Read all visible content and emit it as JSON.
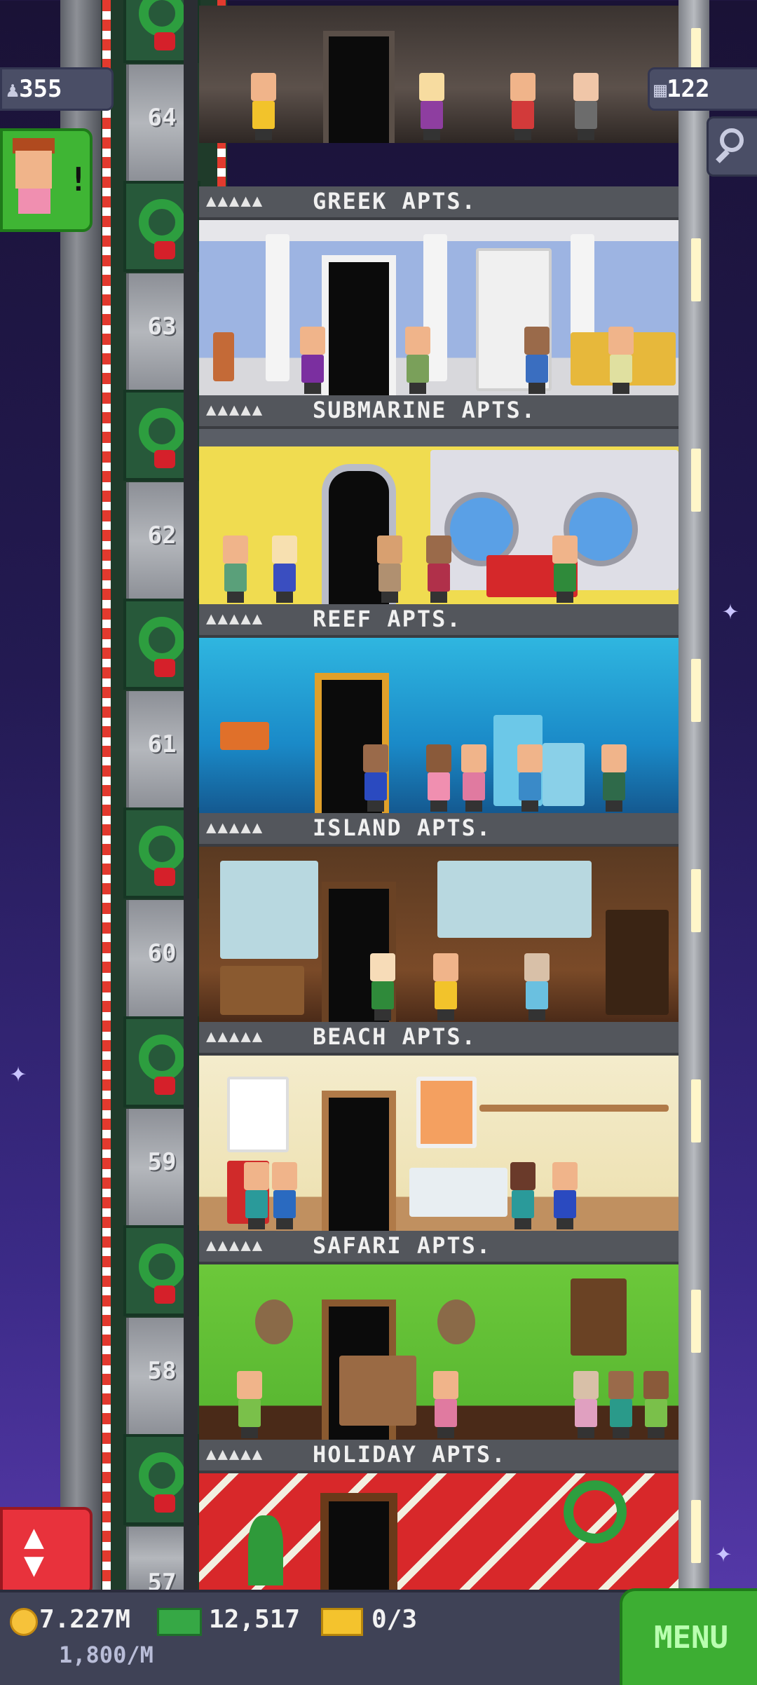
{
  "hud": {
    "population": "355",
    "floors_built": "122",
    "person_icon": "person-icon",
    "building_icon": "building-icon"
  },
  "elevator_floor_numbers": [
    "64",
    "63",
    "62",
    "61",
    "60",
    "59",
    "58",
    "57"
  ],
  "floors": [
    {
      "name": "GREEK APTS.",
      "people_marks": "▲▲▲▲▲"
    },
    {
      "name": "SUBMARINE APTS.",
      "people_marks": "▲▲▲▲▲"
    },
    {
      "name": "REEF APTS.",
      "people_marks": "▲▲▲▲▲"
    },
    {
      "name": "ISLAND APTS.",
      "people_marks": "▲▲▲▲▲"
    },
    {
      "name": "BEACH APTS.",
      "people_marks": "▲▲▲▲▲"
    },
    {
      "name": "SAFARI APTS.",
      "people_marks": "▲▲▲▲▲"
    },
    {
      "name": "HOLIDAY APTS.",
      "people_marks": "▲▲▲▲▲"
    }
  ],
  "bottom": {
    "coins": "7.227M",
    "coin_rate": "1,800/M",
    "bux": "12,517",
    "tickets": "0/3",
    "menu_label": "MENU"
  },
  "colors": {
    "accent_green": "#3dae33",
    "alert_red": "#e8323c",
    "coin_gold": "#f6c23a"
  }
}
